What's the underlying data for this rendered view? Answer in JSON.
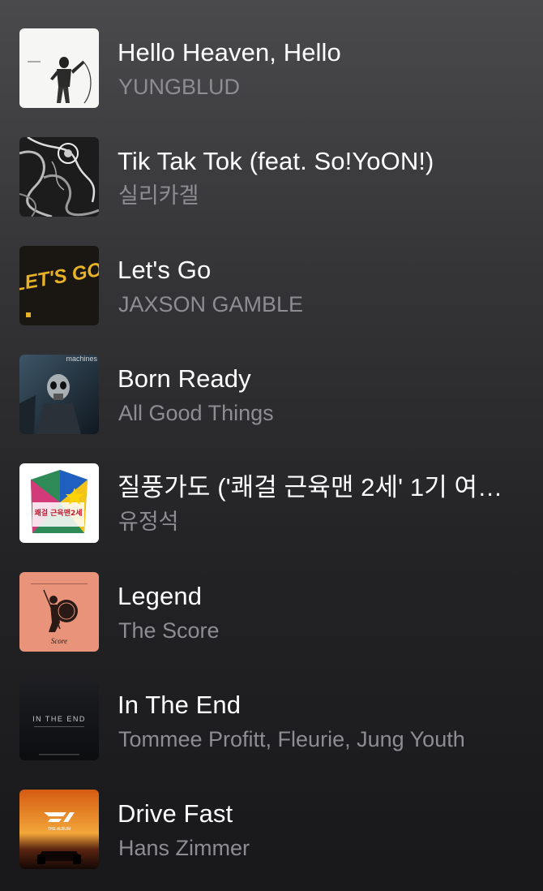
{
  "tracks": [
    {
      "title": "Hello Heaven, Hello",
      "artist": "YUNGBLUD",
      "art": "artwork-yungblud"
    },
    {
      "title": "Tik Tak Tok (feat. So!YoON!)",
      "artist": "실리카겔",
      "art": "artwork-silica-gel"
    },
    {
      "title": "Let's Go",
      "artist": "JAXSON GAMBLE",
      "art": "artwork-lets-go",
      "art_text": "LET'S GO"
    },
    {
      "title": "Born Ready",
      "artist": "All Good Things",
      "art": "artwork-machines",
      "art_text": "machines"
    },
    {
      "title": "질풍가도 ('쾌걸 근육맨 2세' 1기 여…",
      "artist": "유정석",
      "art": "artwork-kinnikuman",
      "art_text": "쾌걸 근육맨2세"
    },
    {
      "title": "Legend",
      "artist": "The Score",
      "art": "artwork-legend",
      "art_text": "Score"
    },
    {
      "title": "In The End",
      "artist": "Tommee Profitt, Fleurie, Jung Youth",
      "art": "artwork-in-the-end",
      "art_text": "IN THE END"
    },
    {
      "title": "Drive Fast",
      "artist": "Hans Zimmer",
      "art": "artwork-f1",
      "art_text": "THE ALBUM"
    }
  ],
  "colors": {
    "title": "#ffffff",
    "artist": "#8d8d92",
    "background_top": "#4a4a4c",
    "background_bottom": "#18181a"
  }
}
